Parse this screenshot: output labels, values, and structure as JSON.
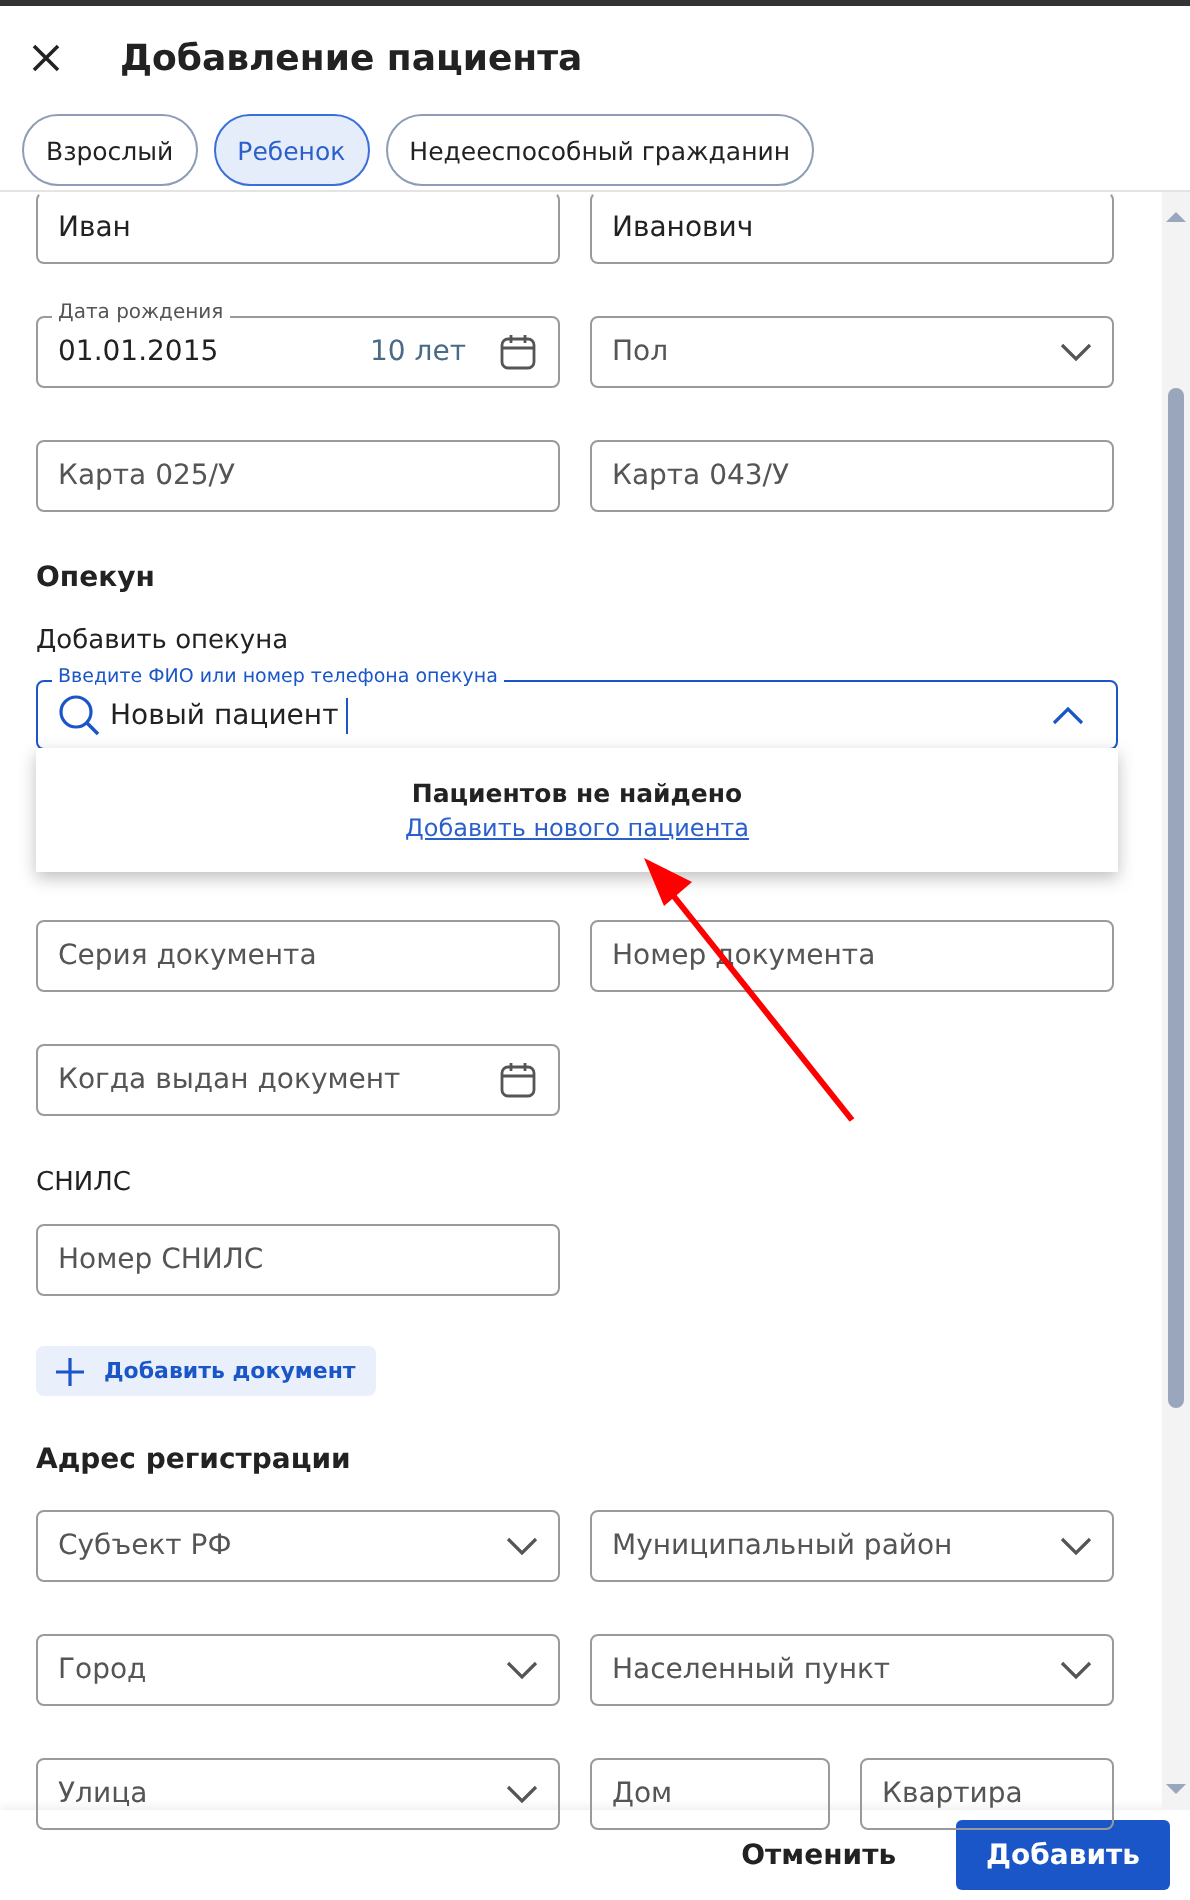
{
  "header": {
    "title": "Добавление пациента"
  },
  "tabs": [
    {
      "label": "Взрослый",
      "selected": false
    },
    {
      "label": "Ребенок",
      "selected": true
    },
    {
      "label": "Недееспособный гражданин",
      "selected": false
    }
  ],
  "content": [
    {
      "kind": "row",
      "fields": [
        {
          "kind": "input",
          "value": "Иван"
        },
        {
          "kind": "input",
          "value": "Иванович"
        }
      ]
    },
    {
      "kind": "row",
      "fields": [
        {
          "kind": "date",
          "label": "Дата рождения",
          "value": "01.01.2015",
          "suffix": "10 лет"
        },
        {
          "kind": "select",
          "placeholder": "Пол"
        }
      ]
    },
    {
      "kind": "row",
      "fields": [
        {
          "kind": "input",
          "placeholder": "Карта 025/У"
        },
        {
          "kind": "input",
          "placeholder": "Карта 043/У"
        }
      ]
    },
    {
      "kind": "heading",
      "text": "Опекун"
    },
    {
      "kind": "label",
      "text": "Добавить опекуна"
    },
    {
      "kind": "guardian",
      "label": "Введите ФИО или номер телефона опекуна",
      "value": "Новый пациент",
      "expanded": true,
      "message": "Пациентов не найдено",
      "link": "Добавить нового пациента"
    },
    {
      "kind": "row",
      "fields": [
        {
          "kind": "input",
          "placeholder": "Серия документа"
        },
        {
          "kind": "input",
          "placeholder": "Номер документа"
        }
      ]
    },
    {
      "kind": "row",
      "fields": [
        {
          "kind": "date",
          "placeholder": "Когда выдан документ"
        }
      ]
    },
    {
      "kind": "label",
      "text": "СНИЛС"
    },
    {
      "kind": "row",
      "fields": [
        {
          "kind": "input",
          "placeholder": "Номер СНИЛС"
        }
      ]
    },
    {
      "kind": "button",
      "text": "Добавить документ"
    },
    {
      "kind": "heading",
      "text": "Адрес регистрации"
    },
    {
      "kind": "row",
      "fields": [
        {
          "kind": "select",
          "placeholder": "Субъект РФ"
        },
        {
          "kind": "select",
          "placeholder": "Муниципальный район"
        }
      ]
    },
    {
      "kind": "row",
      "fields": [
        {
          "kind": "select",
          "placeholder": "Город"
        },
        {
          "kind": "select",
          "placeholder": "Населенный пункт"
        }
      ]
    },
    {
      "kind": "row",
      "fields": [
        {
          "kind": "select",
          "placeholder": "Улица"
        },
        {
          "kind": "input",
          "placeholder": "Дом"
        },
        {
          "kind": "input",
          "placeholder": "Квартира"
        }
      ]
    }
  ],
  "footer": {
    "cancel": "Отменить",
    "submit": "Добавить"
  }
}
